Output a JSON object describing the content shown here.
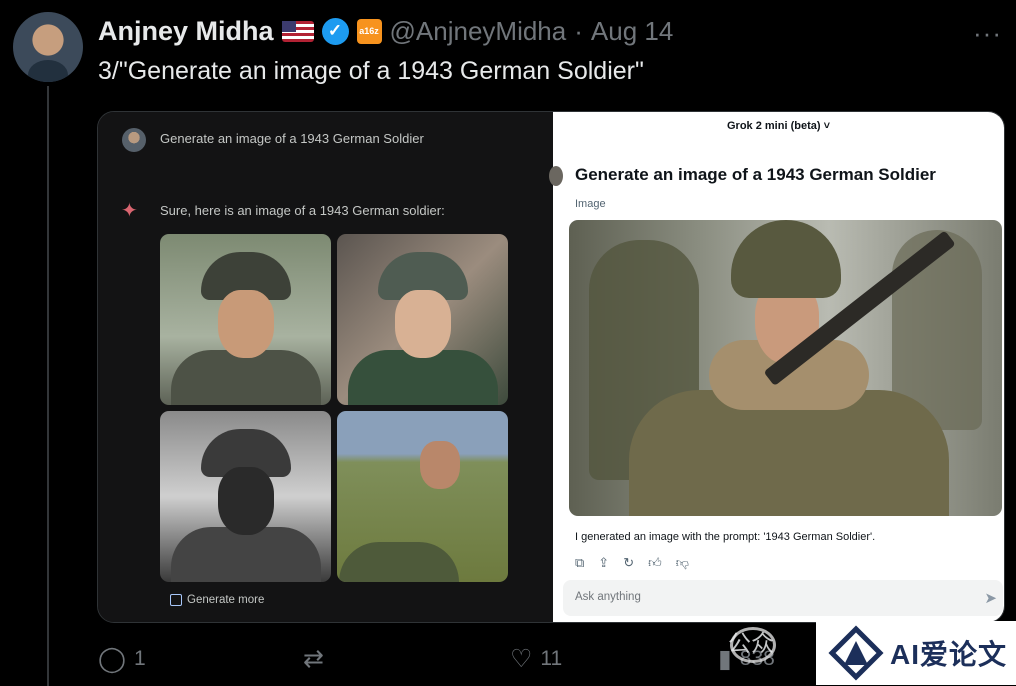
{
  "tweet": {
    "name": "Anjney Midha",
    "handle": "@AnjneyMidha",
    "dot": "·",
    "date": "Aug 14",
    "badge_a16z": "a16z",
    "more": "···",
    "text": "3/\"Generate an image of a 1943 German Soldier\""
  },
  "gemini": {
    "prompt": "Generate an image of a 1943 German Soldier",
    "reply": "Sure, here is an image of a 1943 German soldier:",
    "generate_more": "Generate more"
  },
  "grok": {
    "title": "Grok 2 mini (beta) ˅",
    "prompt": "Generate an image of a 1943 German Soldier",
    "image_label": "Image",
    "reply": "I generated an image with the prompt: '1943 German Soldier'.",
    "input_placeholder": "Ask anything"
  },
  "actions": {
    "replies": "1",
    "reposts": "",
    "likes": "11",
    "views": "838"
  },
  "watermark": {
    "channel_text": "公众",
    "brand": "AI爱论文"
  },
  "colors": {
    "background": "#000000",
    "verified": "#1d9bf0",
    "gemini_spark": "#d96570",
    "muted": "#71767b"
  },
  "icons": [
    "verified-badge-icon",
    "us-flag-icon",
    "a16z-icon",
    "more-icon",
    "gemini-spark-icon",
    "generate-more-icon",
    "copy-icon",
    "share-icon",
    "regenerate-icon",
    "thumbs-up-icon",
    "thumbs-down-icon",
    "send-icon",
    "reply-icon",
    "repost-icon",
    "like-icon",
    "views-icon"
  ]
}
